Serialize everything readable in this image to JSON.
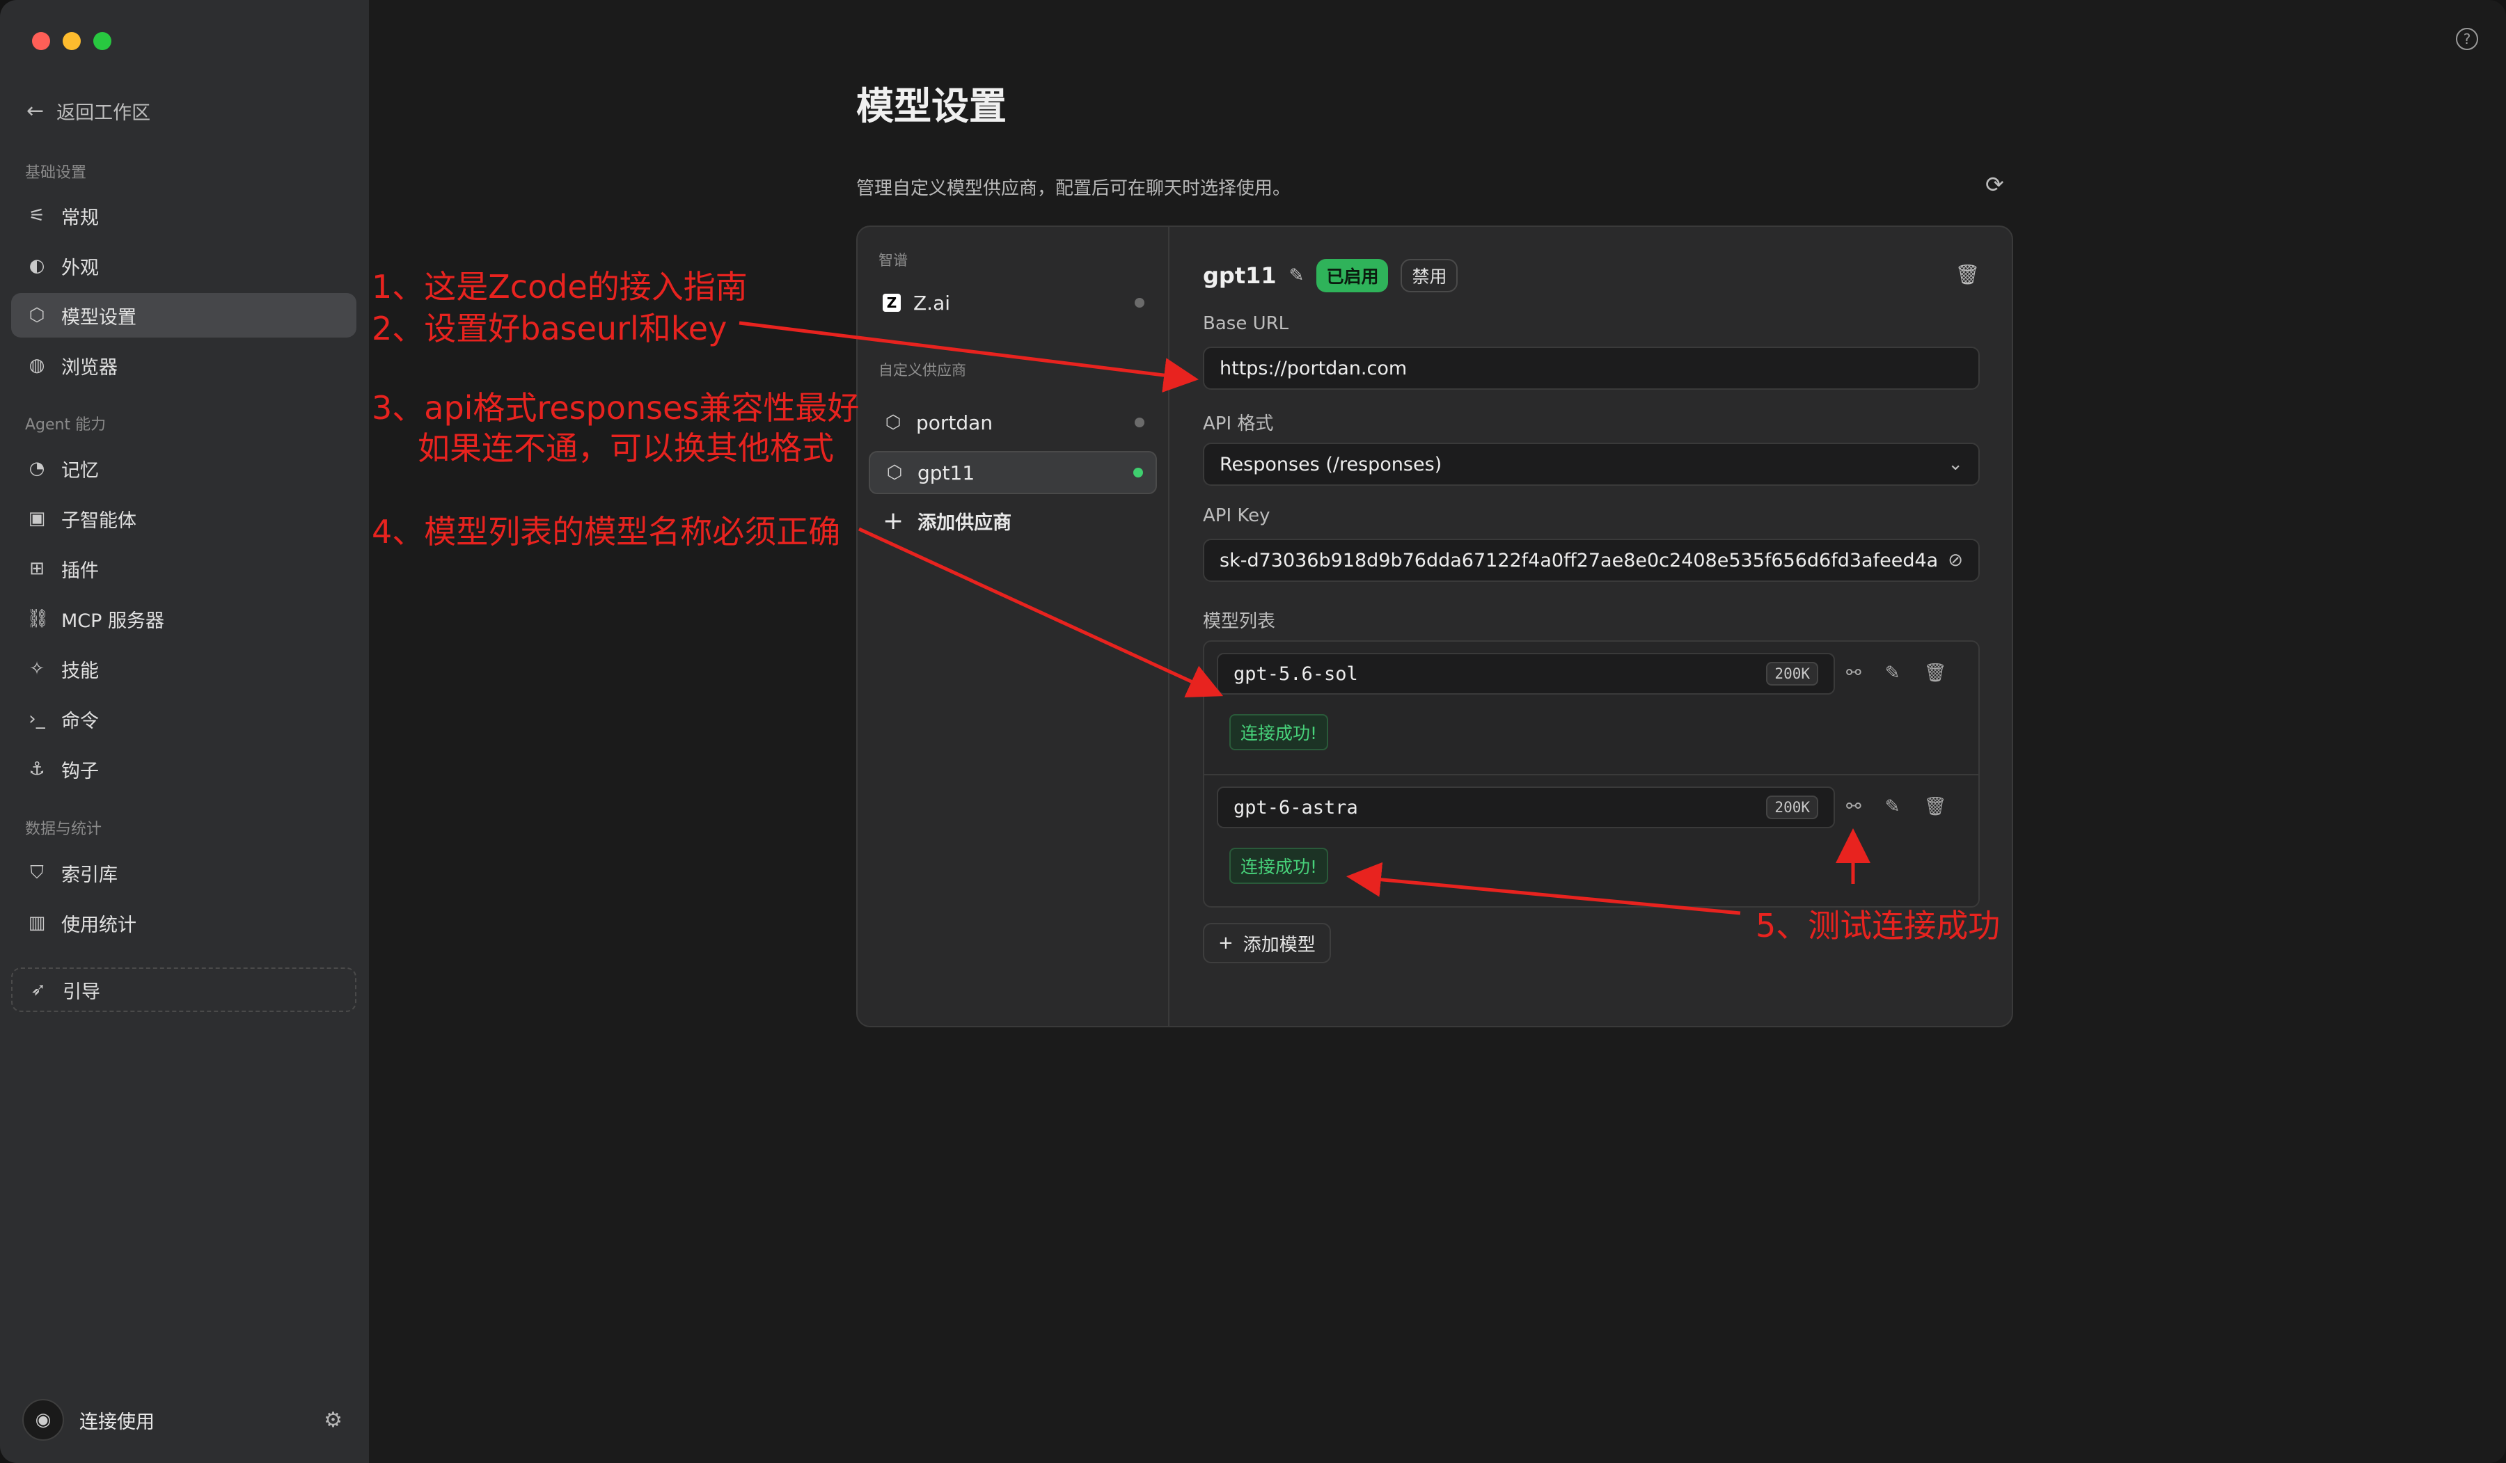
{
  "sidebar": {
    "back_label": "返回工作区",
    "groups": {
      "basic": "基础设置",
      "agent": "Agent 能力",
      "data": "数据与统计"
    },
    "items": [
      {
        "label": "常规",
        "icon": "sliders-icon"
      },
      {
        "label": "外观",
        "icon": "palette-icon"
      },
      {
        "label": "模型设置",
        "icon": "cube-icon"
      },
      {
        "label": "浏览器",
        "icon": "globe-icon"
      },
      {
        "label": "记忆",
        "icon": "brain-icon"
      },
      {
        "label": "子智能体",
        "icon": "robot-icon"
      },
      {
        "label": "插件",
        "icon": "puzzle-icon"
      },
      {
        "label": "MCP 服务器",
        "icon": "server-icon"
      },
      {
        "label": "技能",
        "icon": "wand-icon"
      },
      {
        "label": "命令",
        "icon": "terminal-icon"
      },
      {
        "label": "钩子",
        "icon": "anchor-icon"
      },
      {
        "label": "索引库",
        "icon": "shield-icon"
      },
      {
        "label": "使用统计",
        "icon": "bar-chart-icon"
      },
      {
        "label": "引导",
        "icon": "rocket-icon"
      }
    ],
    "active_item": "模型设置",
    "user_name": "连接使用"
  },
  "main": {
    "title": "模型设置",
    "description": "管理自定义模型供应商，配置后可在聊天时选择使用。",
    "providers": {
      "official_label": "智谱",
      "custom_label": "自定义供应商",
      "official": [
        {
          "name": "Z.ai",
          "status": "inactive"
        }
      ],
      "custom": [
        {
          "name": "portdan",
          "status": "inactive"
        },
        {
          "name": "gpt11",
          "status": "active"
        }
      ],
      "add_label": "添加供应商"
    },
    "detail": {
      "name": "gpt11",
      "enabled_badge": "已启用",
      "disable_button": "禁用",
      "base_url_label": "Base URL",
      "base_url_value": "https://portdan.com",
      "api_format_label": "API 格式",
      "api_format_value": "Responses (/responses)",
      "api_key_label": "API Key",
      "api_key_value": "sk-d73036b918d9b76dda67122f4a0ff27ae8e0c2408e535f656d6fd3afeed4a",
      "models_label": "模型列表",
      "models": [
        {
          "name": "gpt-5.6-sol",
          "context": "200K",
          "status": "连接成功!"
        },
        {
          "name": "gpt-6-astra",
          "context": "200K",
          "status": "连接成功!"
        }
      ],
      "add_model_label": "添加模型"
    }
  },
  "annotations": {
    "a1": "1、这是Zcode的接入指南",
    "a2": "2、设置好baseurl和key",
    "a3a": "3、api格式responses兼容性最好",
    "a3b": "如果连不通，可以换其他格式",
    "a4": "4、模型列表的模型名称必须正确",
    "a5": "5、测试连接成功",
    "color": "#e8231f"
  },
  "colors": {
    "accent_green": "#2fb35a",
    "sidebar_bg": "#2d2e30",
    "main_bg": "#1b1b1b"
  }
}
